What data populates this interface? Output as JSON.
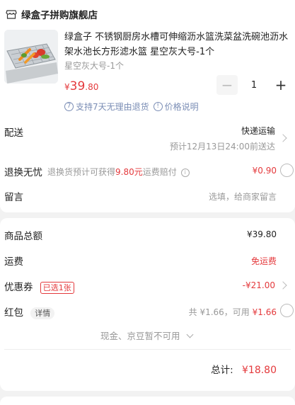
{
  "shop": {
    "name": "绿盒子拼购旗舰店",
    "icon": "store-icon"
  },
  "product": {
    "title": "绿盒子 不锈钢厨房水槽可伸缩沥水篮洗菜盆洗碗池沥水架水池长方形滤水篮 星空灰大号-1个",
    "spec": "星空灰大号-1个",
    "price_symbol": "¥",
    "price_int": "39",
    "price_dec": ".80",
    "quantity": "1",
    "image": "dish-rack-with-vegetables"
  },
  "service": {
    "return_policy": "支持7天无理由退货",
    "price_note": "价格说明",
    "return_icon_glyph": "7",
    "price_icon_glyph": "!"
  },
  "delivery": {
    "label": "配送",
    "method": "快递运输",
    "eta": "预计12月13日24:00前送达"
  },
  "return_worry": {
    "label": "退换无忧",
    "desc_prefix": "退换货预计可获得",
    "desc_amount": "9.80元",
    "desc_suffix": "运费赔付",
    "price": "¥0.90"
  },
  "message": {
    "label": "留言",
    "placeholder": "选填，给商家留言"
  },
  "summary": {
    "total_label": "商品总额",
    "total_value": "¥39.80",
    "shipping_label": "运费",
    "shipping_value": "免运费",
    "coupon_label": "优惠券",
    "coupon_tag": "已选1张",
    "coupon_value": "-¥21.00",
    "redpacket_label": "红包",
    "redpacket_detail": "详情",
    "redpacket_desc": "共 ¥1.66，可用",
    "redpacket_value": "¥1.66",
    "unavailable": "现金、京豆暂不可用",
    "grand_label": "总计:",
    "grand_value": "¥18.80"
  },
  "colors": {
    "accent": "#e4393c",
    "link": "#7a8db5",
    "muted": "#999999"
  }
}
